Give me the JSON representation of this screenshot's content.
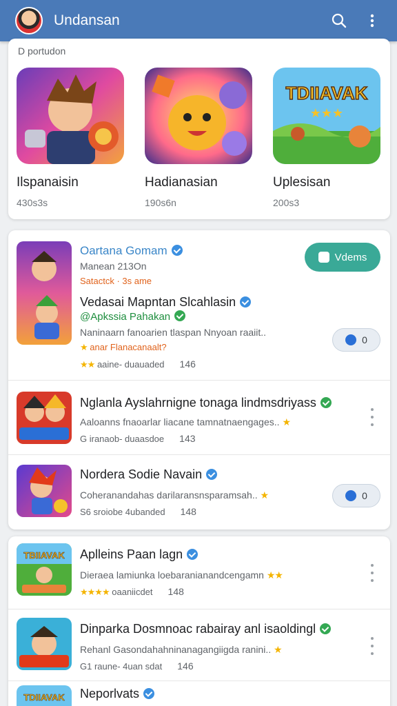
{
  "appbar": {
    "title": "Undansan",
    "icons": [
      "search-icon",
      "more-vert-icon"
    ]
  },
  "featured": {
    "section_label": "D portudon",
    "items": [
      {
        "name": "Ilspanaisin",
        "sub": "430s3s"
      },
      {
        "name": "Hadianasian",
        "sub": "190s6n"
      },
      {
        "name": "Uplesisan",
        "sub": "200s3"
      }
    ],
    "badge_text": "TDIIAVAK"
  },
  "top_card": {
    "developer": "Oartana Gomam",
    "date": "Manean 213On",
    "rank": "Satactck · 3s ame",
    "cta_label": "Vdems",
    "title": "Vedasai Mapntan Slcahlasin",
    "publisher": "@Apkssia Pahakan",
    "desc": "Naninaarn fanoarien tlaspan Nnyoan raaiit..",
    "tag": "anar Flanacanaalt?",
    "meta": "aaine- duauaded",
    "count": "146",
    "pill_label": "0"
  },
  "rows": [
    {
      "title": "Nglanla Ayslahrnigne tonaga lindmsdriyass",
      "desc": "Aaloanns fnaoarlar liacane tamnatnaengages..",
      "meta": "G iranaob- duaasdoe",
      "count": "143"
    },
    {
      "title": "Nordera Sodie Navain",
      "desc": "Coheranandahas darilaransnsparamsah..",
      "meta": "S6 sroiobe 4ubanded",
      "count": "148",
      "pill_label": "0"
    }
  ],
  "list2": [
    {
      "title": "Aplleins Paan lagn",
      "desc": "Dieraea lamiunka loebaranianandcengamn",
      "meta": "oaaniicdet",
      "count": "148"
    },
    {
      "title": "Dinparka Dosmnoac rabairay anl isaoldingl",
      "desc": "Rehanl Gasondahahninanagangiigda ranini..",
      "meta": "G1 raune- 4uan sdat",
      "count": "146"
    },
    {
      "title": "Neporlvats"
    }
  ]
}
